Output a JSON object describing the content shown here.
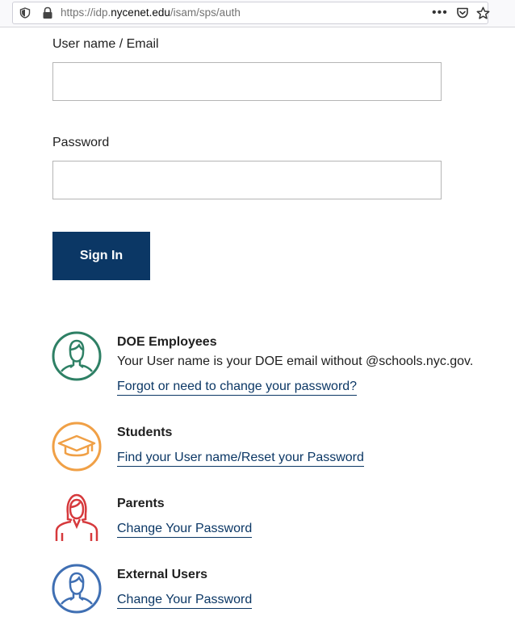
{
  "browser": {
    "url_prefix": "https://idp.",
    "url_domain": "nycenet.edu",
    "url_path": "/isam/sps/auth",
    "more_glyph": "•••"
  },
  "form": {
    "username_label": "User name / Email",
    "username_value": "",
    "password_label": "Password",
    "password_value": "",
    "signin_label": "Sign In"
  },
  "help": {
    "doe": {
      "title": "DOE Employees",
      "text": "Your User name is your DOE email without @schools.nyc.gov.",
      "link": "Forgot or need to change your password?",
      "icon": "employee-icon",
      "color": "#2e8065"
    },
    "students": {
      "title": "Students",
      "link": "Find your User name/Reset your Password",
      "icon": "graduation-cap-icon",
      "color": "#f0a046"
    },
    "parents": {
      "title": "Parents",
      "link": "Change Your Password",
      "icon": "parent-icon",
      "color": "#d6393c"
    },
    "external": {
      "title": "External Users",
      "link": "Change Your Password",
      "icon": "external-user-icon",
      "color": "#3f6fb3"
    }
  },
  "colors": {
    "primary": "#0b3765",
    "text": "#1f1f1f",
    "input_border": "#b5b5b5"
  }
}
